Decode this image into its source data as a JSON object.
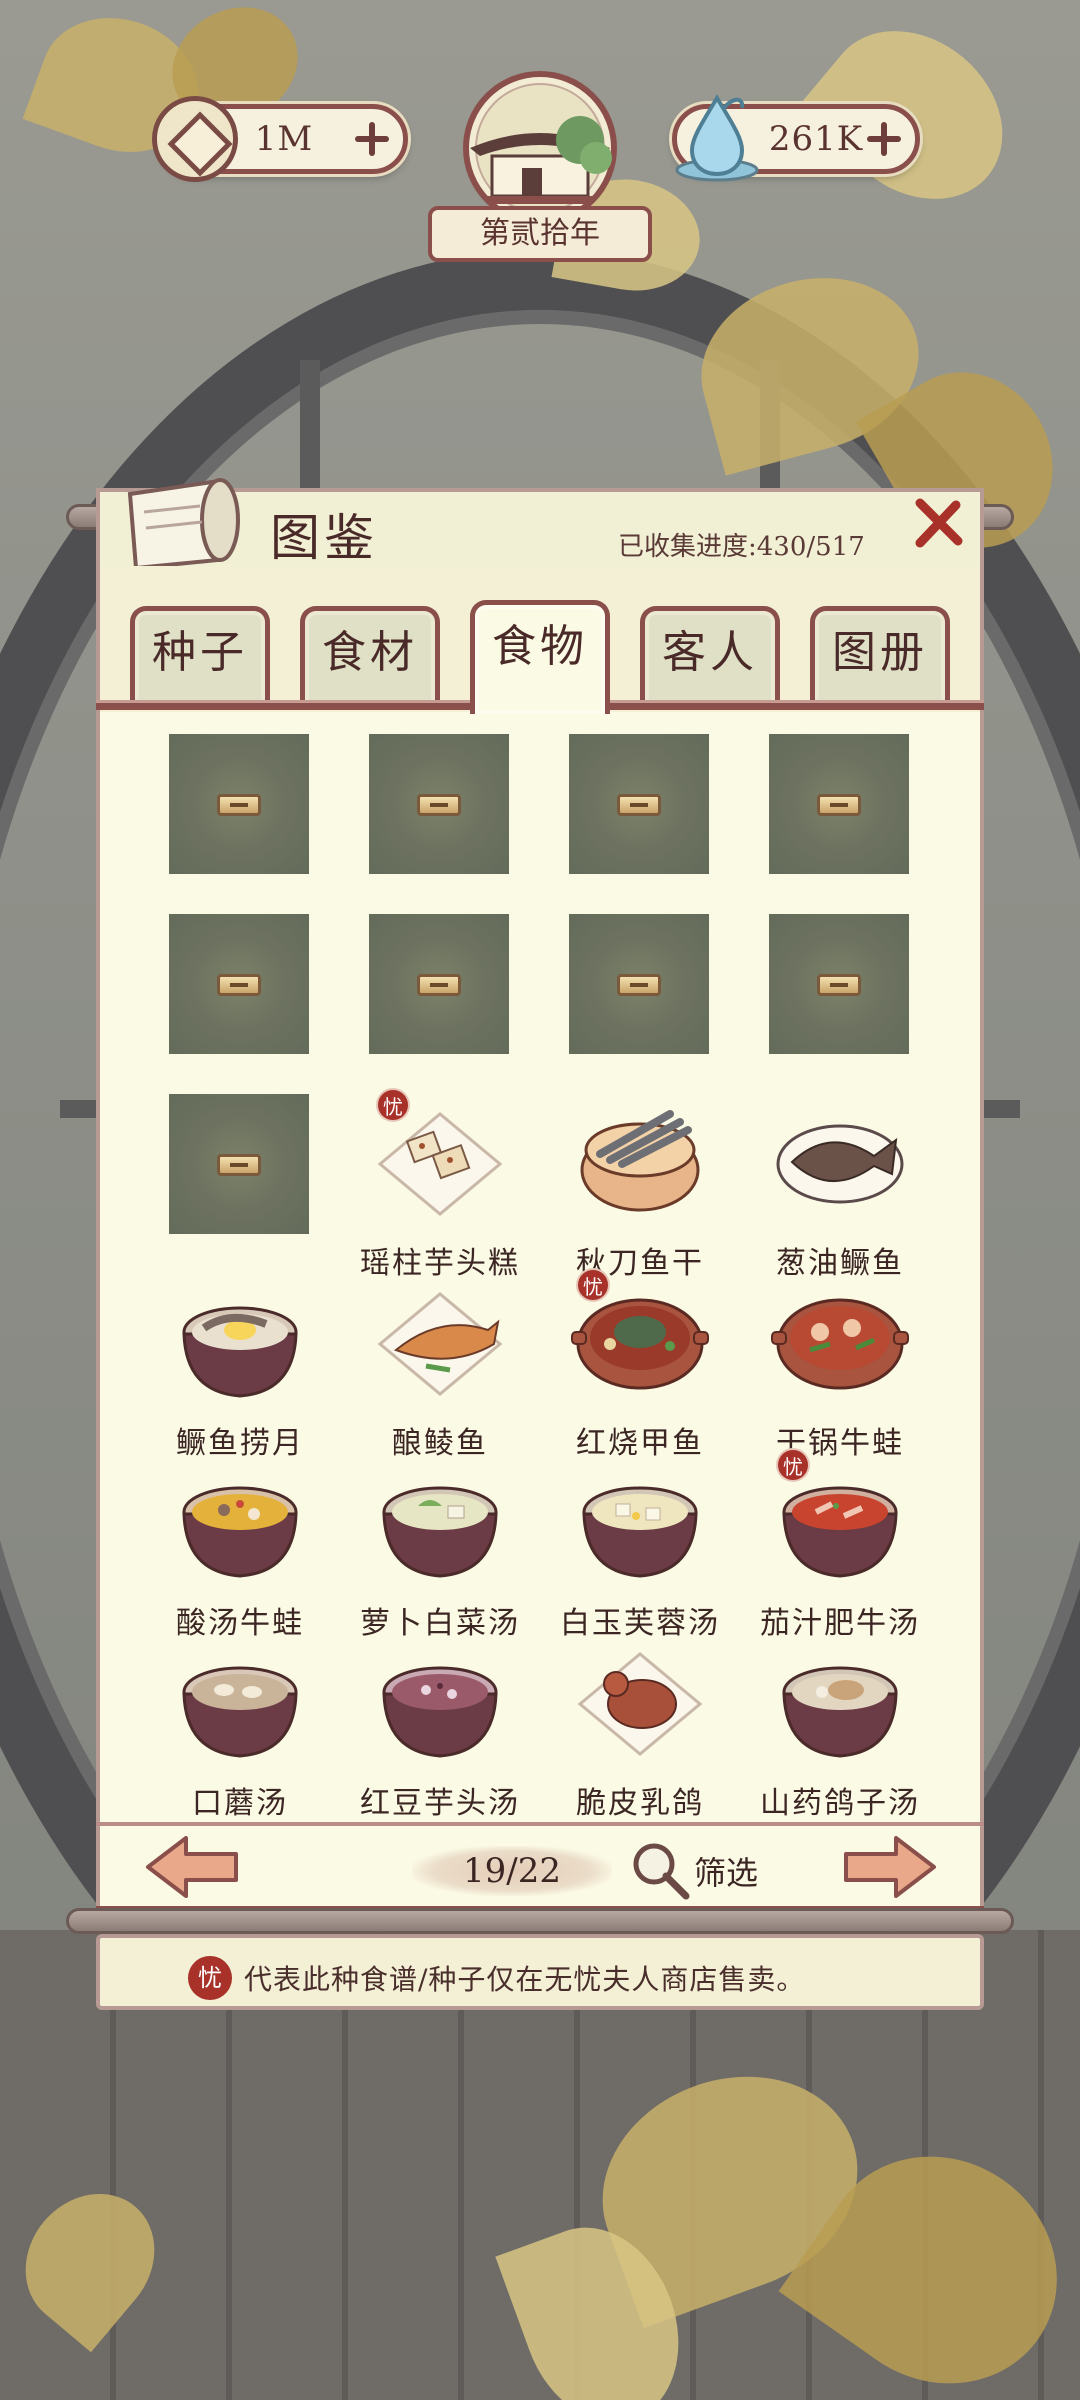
{
  "resources": {
    "coins": "1M",
    "water": "261K"
  },
  "year_label": "第贰拾年",
  "panel": {
    "title": "图鉴",
    "progress": "已收集进度:430/517"
  },
  "tabs": [
    {
      "label": "种子",
      "active": false
    },
    {
      "label": "食材",
      "active": false
    },
    {
      "label": "食物",
      "active": true
    },
    {
      "label": "客人",
      "active": false
    },
    {
      "label": "图册",
      "active": false
    }
  ],
  "grid": {
    "locked_count": 9,
    "dishes": [
      {
        "name": "瑶柱芋头糕",
        "shop_only": true,
        "icon": "taro-cake-plate"
      },
      {
        "name": "秋刀鱼干",
        "shop_only": false,
        "icon": "dried-fish-steamer"
      },
      {
        "name": "葱油鳜鱼",
        "shop_only": false,
        "icon": "whole-fish-plate"
      },
      {
        "name": "鳜鱼捞月",
        "shop_only": false,
        "icon": "fish-egg-bowl"
      },
      {
        "name": "酿鲮鱼",
        "shop_only": false,
        "icon": "stuffed-fish-plate"
      },
      {
        "name": "红烧甲鱼",
        "shop_only": true,
        "icon": "turtle-claypot"
      },
      {
        "name": "干锅牛蛙",
        "shop_only": false,
        "icon": "frog-claypot"
      },
      {
        "name": "酸汤牛蛙",
        "shop_only": false,
        "icon": "sour-soup-pot"
      },
      {
        "name": "萝卜白菜汤",
        "shop_only": false,
        "icon": "veg-soup-pot"
      },
      {
        "name": "白玉芙蓉汤",
        "shop_only": false,
        "icon": "tofu-soup-pot"
      },
      {
        "name": "茄汁肥牛汤",
        "shop_only": true,
        "icon": "tomato-beef-pot"
      },
      {
        "name": "口蘑汤",
        "shop_only": false,
        "icon": "mushroom-soup-bowl"
      },
      {
        "name": "红豆芋头汤",
        "shop_only": false,
        "icon": "red-bean-soup-bowl"
      },
      {
        "name": "脆皮乳鸽",
        "shop_only": false,
        "icon": "roast-pigeon-plate"
      },
      {
        "name": "山药鸽子汤",
        "shop_only": false,
        "icon": "pigeon-soup-bowl"
      }
    ]
  },
  "pagination": {
    "page": "19/22",
    "filter_label": "筛选"
  },
  "footer": {
    "badge": "忧",
    "note": "代表此种食谱/种子仅在无忧夫人商店售卖。"
  },
  "badge_char": "忧",
  "colors": {
    "frame": "#8a4f4b",
    "panel_bg": "#fbfae5",
    "badge_red": "#a8322a"
  }
}
